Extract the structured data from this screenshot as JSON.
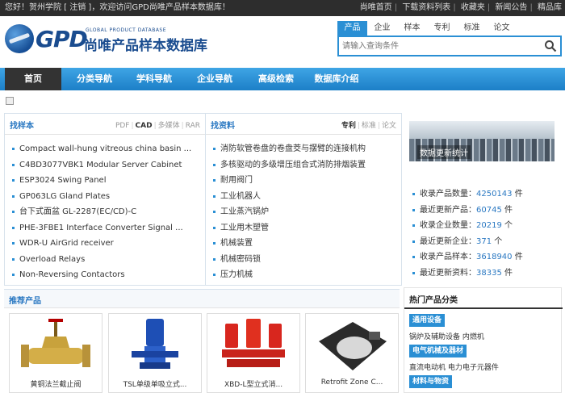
{
  "topbar": {
    "greeting": "您好！贺州学院 [ 注销 ]，欢迎访问GPD尚唯产品样本数据库！",
    "links": [
      "尚唯首页",
      "下载资料列表",
      "收藏夹",
      "新闻公告",
      "精品库"
    ]
  },
  "logo": {
    "brand": "GPD",
    "subtitle": "GLOBAL PRODUCT DATABASE",
    "name": "尚唯产品样本数据库"
  },
  "search": {
    "tabs": [
      "产品",
      "企业",
      "样本",
      "专利",
      "标准",
      "论文"
    ],
    "active_tab": "产品",
    "placeholder": "请输入查询条件"
  },
  "nav": [
    "首页",
    "分类导航",
    "学科导航",
    "企业导航",
    "高级检索",
    "数据库介绍"
  ],
  "samples": {
    "title": "找样本",
    "tabs": [
      "PDF",
      "CAD",
      "多媒体",
      "RAR"
    ],
    "active_tab": "CAD",
    "items": [
      "Compact wall-hung vitreous china basin ...",
      "C4BD3077VBK1 Modular Server Cabinet",
      "ESP3024 Swing Panel",
      "GP063LG Gland Plates",
      "台下式面盆 GL-2287(EC/CD)-C",
      "PHE-3FBE1 Interface Converter Signal ...",
      "WDR-U AirGrid receiver",
      "Overload Relays",
      "Non-Reversing Contactors"
    ]
  },
  "materials": {
    "title": "找资料",
    "tabs": [
      "专利",
      "标准",
      "论文"
    ],
    "active_tab": "专利",
    "items": [
      "消防软管卷盘的卷盘茭与摆臂的连接机构",
      "多核驱动的多级增压组合式消防排烟装置",
      "耐用阀门",
      "工业机器人",
      "工业蒸汽锅炉",
      "工业用木塑管",
      "机械装置",
      "机械密码锁",
      "压力机械"
    ]
  },
  "stats": {
    "image_label": "数据更新统计",
    "rows": [
      {
        "label": "收录产品数量：",
        "value": "4250143",
        "unit": "件"
      },
      {
        "label": "最近更新产品：",
        "value": "60745",
        "unit": "件"
      },
      {
        "label": "收录企业数量：",
        "value": "20219",
        "unit": "个"
      },
      {
        "label": "最近更新企业：",
        "value": "371",
        "unit": "个"
      },
      {
        "label": "收录产品样本：",
        "value": "3618940",
        "unit": "件"
      },
      {
        "label": "最近更新资料：",
        "value": "38335",
        "unit": "件"
      }
    ]
  },
  "recommended": {
    "title": "推荐产品",
    "products": [
      "黄铜法兰截止阀",
      "TSL单级单吸立式...",
      "XBD-L型立式消...",
      "Retrofit Zone C..."
    ]
  },
  "hot": {
    "title": "热门产品分类",
    "groups": [
      {
        "tag": "通用设备",
        "items": "锅炉及辅助设备  内燃机"
      },
      {
        "tag": "电气机械及器材",
        "items": "直流电动机  电力电子元器件"
      },
      {
        "tag": "材料与物资",
        "items": ""
      }
    ]
  },
  "colors": {
    "brand_blue": "#2a8fd4",
    "nav_dark": "#333333",
    "logo_blue": "#1a4c8f"
  }
}
